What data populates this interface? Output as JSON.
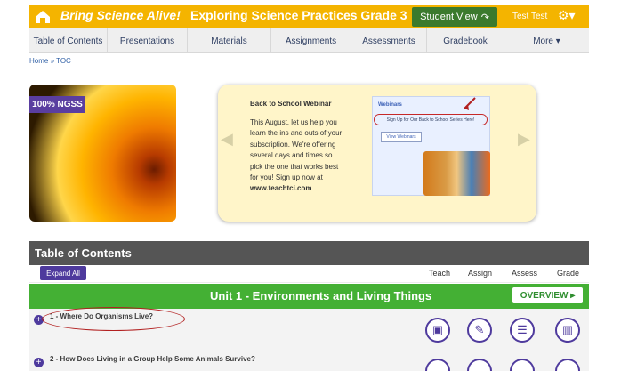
{
  "header": {
    "brand": "Bring Science Alive!",
    "course_title": "Exploring Science Practices Grade 3",
    "student_view_label": "Student View",
    "user_name": "Test Test",
    "gear_label": "⚙▾"
  },
  "nav": {
    "items": [
      "Table of Contents",
      "Presentations",
      "Materials",
      "Assignments",
      "Assessments",
      "Gradebook",
      "More ▾"
    ]
  },
  "breadcrumb": "Home » TOC",
  "hero": {
    "badge": "100% NGSS"
  },
  "promo": {
    "title": "Back to School Webinar",
    "body": "This August, let us help you learn the ins and outs of your subscription. We're offering several days and times so pick the one that works best for you! Sign up now at ",
    "url": "www.teachtci.com",
    "webinar_label": "Webinars",
    "webinar_link": "Sign Up for Our Back to School Series Here!",
    "webinar_button": "View Webinars"
  },
  "toc": {
    "title": "Table of Contents",
    "expand_all": "Expand All",
    "columns": [
      "Teach",
      "Assign",
      "Assess",
      "Grade"
    ],
    "unit_title": "Unit 1 - Environments and Living Things",
    "overview": "OVERVIEW ▸",
    "lessons": [
      "1 - Where Do Organisms Live?",
      "2 - How Does Living in a Group Help Some Animals Survive?"
    ]
  },
  "icons": {
    "teach": "presentation-icon",
    "assign": "pencil-icon",
    "assess": "list-icon",
    "grade": "bar-chart-icon"
  }
}
